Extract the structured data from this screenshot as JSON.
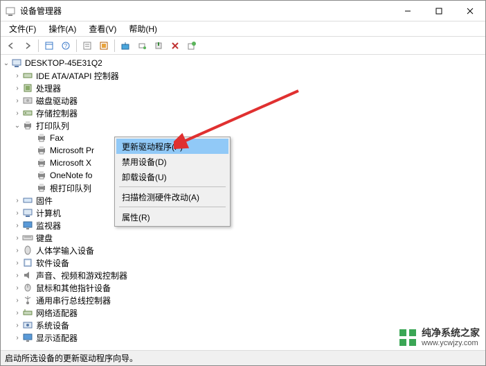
{
  "window": {
    "title": "设备管理器"
  },
  "menu": {
    "file": "文件(F)",
    "action": "操作(A)",
    "view": "查看(V)",
    "help": "帮助(H)"
  },
  "tree": {
    "root": "DESKTOP-45E31Q2",
    "items": [
      {
        "label": "IDE ATA/ATAPI 控制器",
        "icon": "ide"
      },
      {
        "label": "处理器",
        "icon": "cpu"
      },
      {
        "label": "磁盘驱动器",
        "icon": "disk"
      },
      {
        "label": "存储控制器",
        "icon": "storage"
      },
      {
        "label": "打印队列",
        "icon": "printer",
        "expanded": true,
        "children": [
          {
            "label": "Fax",
            "icon": "printer"
          },
          {
            "label": "Microsoft Pr",
            "icon": "printer"
          },
          {
            "label": "Microsoft X",
            "icon": "printer"
          },
          {
            "label": "OneNote fo",
            "icon": "printer"
          },
          {
            "label": "根打印队列",
            "icon": "printer"
          }
        ]
      },
      {
        "label": "固件",
        "icon": "firmware"
      },
      {
        "label": "计算机",
        "icon": "computer"
      },
      {
        "label": "监视器",
        "icon": "monitor"
      },
      {
        "label": "键盘",
        "icon": "keyboard"
      },
      {
        "label": "人体学输入设备",
        "icon": "hid"
      },
      {
        "label": "软件设备",
        "icon": "software"
      },
      {
        "label": "声音、视频和游戏控制器",
        "icon": "audio"
      },
      {
        "label": "鼠标和其他指针设备",
        "icon": "mouse"
      },
      {
        "label": "通用串行总线控制器",
        "icon": "usb"
      },
      {
        "label": "网络适配器",
        "icon": "network"
      },
      {
        "label": "系统设备",
        "icon": "system"
      },
      {
        "label": "显示适配器",
        "icon": "display"
      }
    ]
  },
  "context": {
    "update": "更新驱动程序(P)",
    "disable": "禁用设备(D)",
    "uninstall": "卸载设备(U)",
    "scan": "扫描检测硬件改动(A)",
    "properties": "属性(R)"
  },
  "status": "启动所选设备的更新驱动程序向导。",
  "watermark": {
    "text": "纯净系统之家",
    "url": "www.ycwjzy.com"
  }
}
